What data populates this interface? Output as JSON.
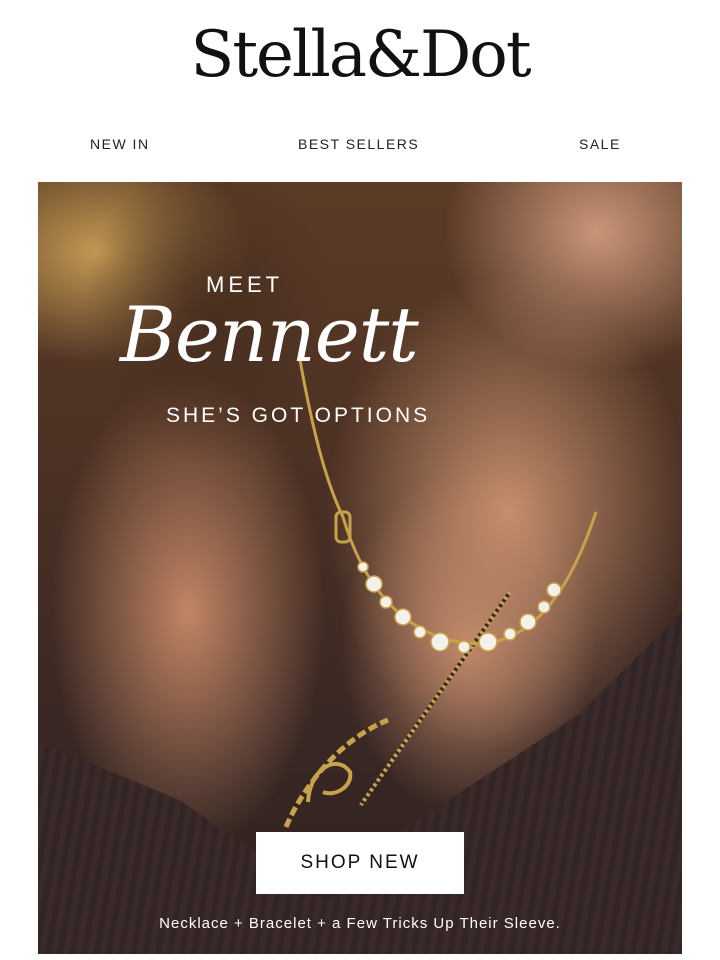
{
  "header": {
    "logo_text": "Stella&Dot"
  },
  "nav": {
    "items": [
      {
        "label": "NEW IN"
      },
      {
        "label": "BEST SELLERS"
      },
      {
        "label": "SALE"
      }
    ]
  },
  "hero": {
    "eyebrow": "MEET",
    "title": "Bennett",
    "subtitle": "SHE’S GOT OPTIONS",
    "cta_label": "SHOP NEW",
    "caption": "Necklace + Bracelet + a Few Tricks Up Their Sleeve."
  },
  "colors": {
    "text_dark": "#111111",
    "overlay_text": "#ffffff",
    "gold": "#c8a24a",
    "sweater": "#3a2b2a"
  }
}
